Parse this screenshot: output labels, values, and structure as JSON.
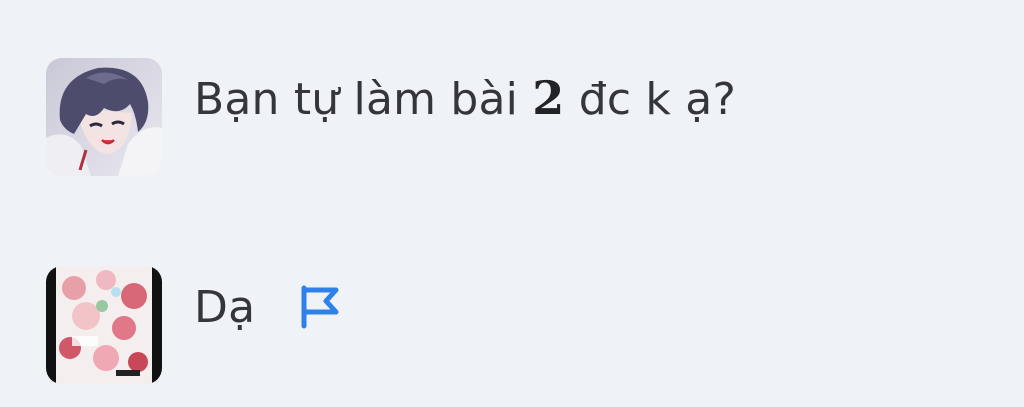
{
  "comments": [
    {
      "text_before": "Bạn tự làm bài ",
      "math": "2",
      "text_after": " đc k ạ?"
    },
    {
      "text": "Dạ",
      "flag_icon": "flag-icon",
      "flag_color": "#2f80e8"
    }
  ]
}
